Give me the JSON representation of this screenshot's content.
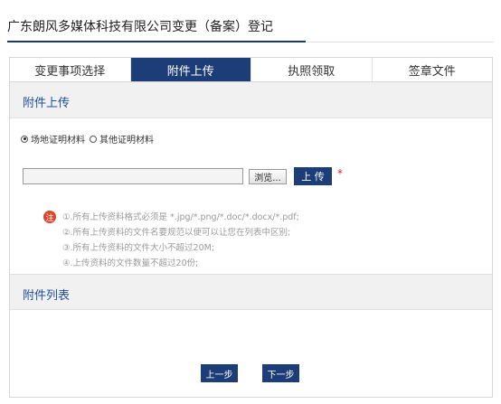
{
  "page": {
    "title": "广东朗风多媒体科技有限公司变更（备案）登记"
  },
  "tabs": [
    {
      "label": "变更事项选择",
      "active": false
    },
    {
      "label": "附件上传",
      "active": true
    },
    {
      "label": "执照领取",
      "active": false
    },
    {
      "label": "签章文件",
      "active": false
    }
  ],
  "upload_section": {
    "title": "附件上传"
  },
  "radios": [
    {
      "label": "场地证明材料",
      "checked": true
    },
    {
      "label": "其他证明材料",
      "checked": false
    }
  ],
  "file": {
    "value": "",
    "browse_label": "浏览...",
    "upload_label": "上 传",
    "required_mark": "*"
  },
  "notes": {
    "badge": "注",
    "items": [
      "①.所有上传资料格式必须是 *.jpg/*.png/*.doc/*.docx/*.pdf;",
      "②.所有上传资料的文件名要规范以便可以让您在列表中区别;",
      "③.所有上传资料的文件大小不超过20M;",
      "④.上传资料的文件数量不超过20份;"
    ]
  },
  "list_section": {
    "title": "附件列表"
  },
  "nav": {
    "prev_label": "上一步",
    "next_label": "下一步"
  },
  "colors": {
    "accent": "#1c3d78",
    "link": "#1e4f9a",
    "required": "#e02020",
    "note_badge": "#d9472b"
  }
}
